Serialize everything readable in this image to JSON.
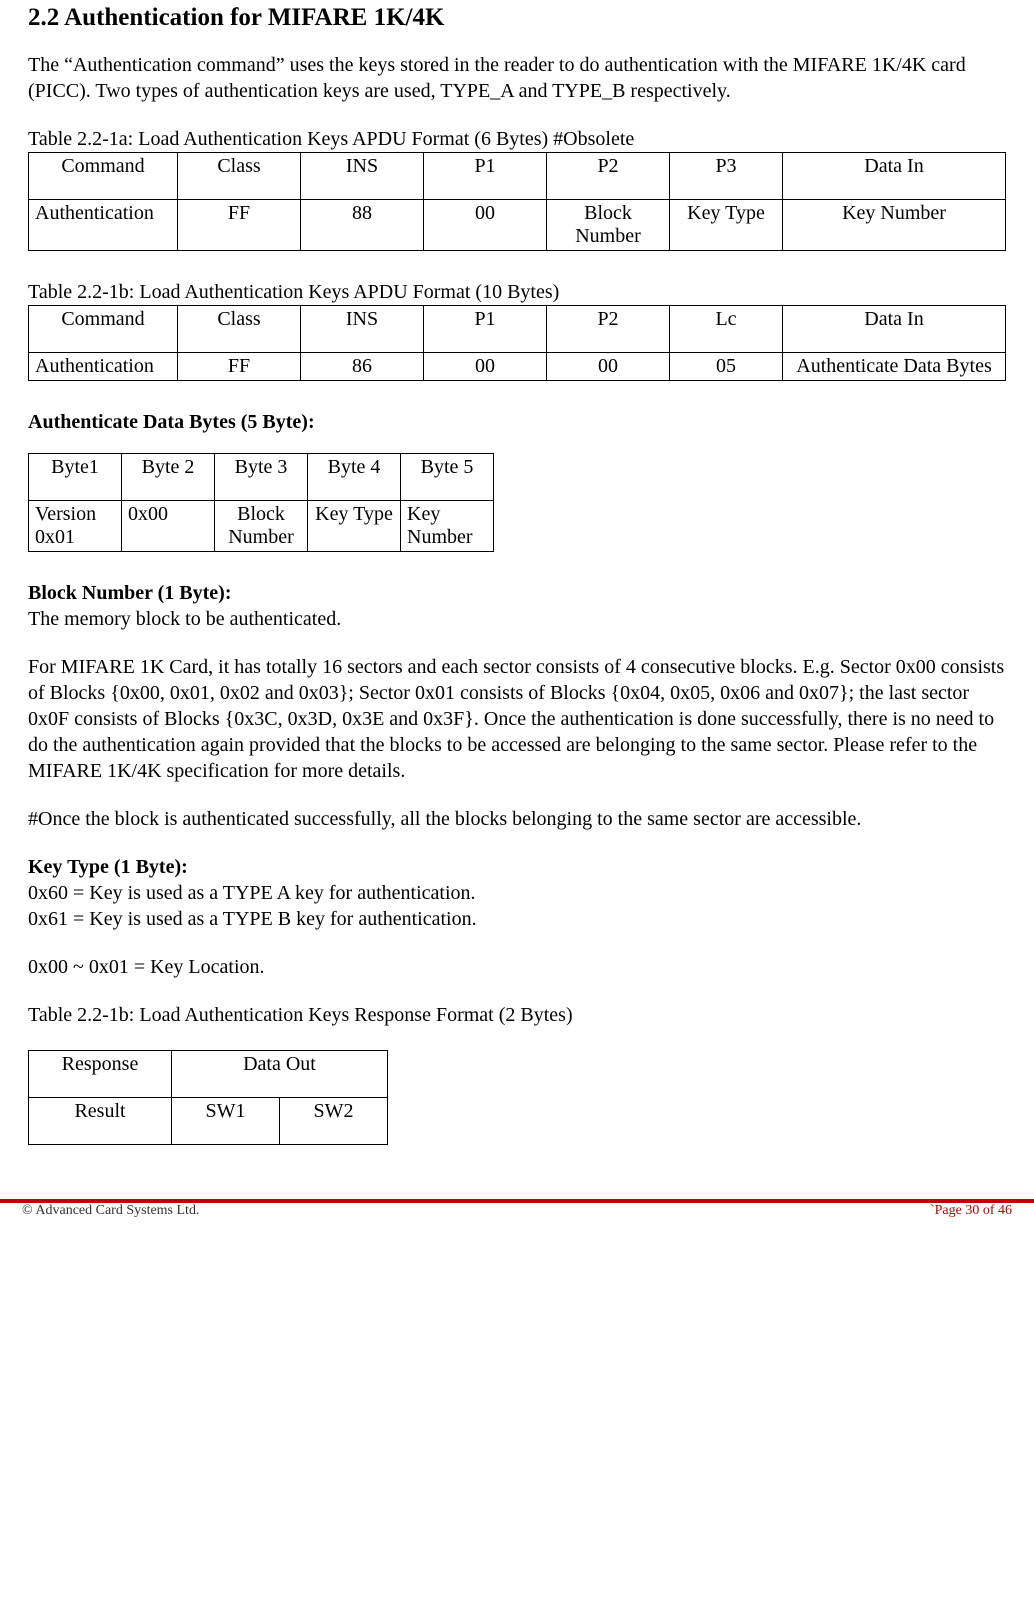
{
  "section": {
    "title": "2.2 Authentication for MIFARE 1K/4K",
    "intro": "The “Authentication command” uses the keys stored in the reader to do authentication with the MIFARE 1K/4K card (PICC). Two types of authentication keys are used, TYPE_A and TYPE_B respectively."
  },
  "table1": {
    "caption": "Table 2.2-1a: Load Authentication Keys APDU Format (6 Bytes) #Obsolete",
    "headers": [
      "Command",
      "Class",
      "INS",
      "P1",
      "P2",
      "P3",
      "Data In"
    ],
    "row": [
      "Authentication",
      "FF",
      "88",
      "00",
      "Block Number",
      "Key Type",
      "Key Number"
    ]
  },
  "table2": {
    "caption": "Table 2.2-1b: Load Authentication Keys APDU Format (10 Bytes)",
    "headers": [
      "Command",
      "Class",
      "INS",
      "P1",
      "P2",
      "Lc",
      "Data In"
    ],
    "row": [
      "Authentication",
      "FF",
      "86",
      "00",
      "00",
      "05",
      "Authenticate Data Bytes"
    ]
  },
  "adb": {
    "heading": "Authenticate Data Bytes (5 Byte):",
    "headers": [
      "Byte1",
      "Byte 2",
      "Byte 3",
      "Byte 4",
      "Byte 5"
    ],
    "row": [
      "Version 0x01",
      "0x00",
      "Block Number",
      "Key Type",
      "Key Number"
    ]
  },
  "blocknum": {
    "heading": "Block Number (1 Byte):",
    "desc": "The memory block to be authenticated.",
    "para": "For MIFARE 1K Card, it has totally 16 sectors and each sector consists of 4 consecutive blocks. E.g. Sector 0x00 consists of Blocks {0x00, 0x01, 0x02 and 0x03}; Sector 0x01 consists of Blocks {0x04, 0x05, 0x06 and 0x07}; the last sector 0x0F consists of Blocks {0x3C, 0x3D, 0x3E and 0x3F}. Once the authentication is done successfully, there is no need to do the authentication again provided that the blocks to be accessed are belonging to the same sector. Please refer to the MIFARE 1K/4K specification for more details.",
    "note": "#Once the block is authenticated successfully, all the blocks belonging to the same sector are accessible."
  },
  "keytype": {
    "heading": "Key Type (1 Byte):",
    "line1": "0x60 = Key is used as a TYPE A key for authentication.",
    "line2": "0x61 = Key is used as a TYPE B key for authentication.",
    "line3": "0x00 ~ 0x01 = Key Location."
  },
  "resp": {
    "caption": "Table 2.2-1b: Load Authentication Keys Response Format (2 Bytes)",
    "headers": [
      "Response",
      "Data Out"
    ],
    "row": [
      "Result",
      "SW1",
      "SW2"
    ]
  },
  "footer": {
    "left": "© Advanced Card Systems Ltd.",
    "right": "`Page 30 of 46"
  }
}
